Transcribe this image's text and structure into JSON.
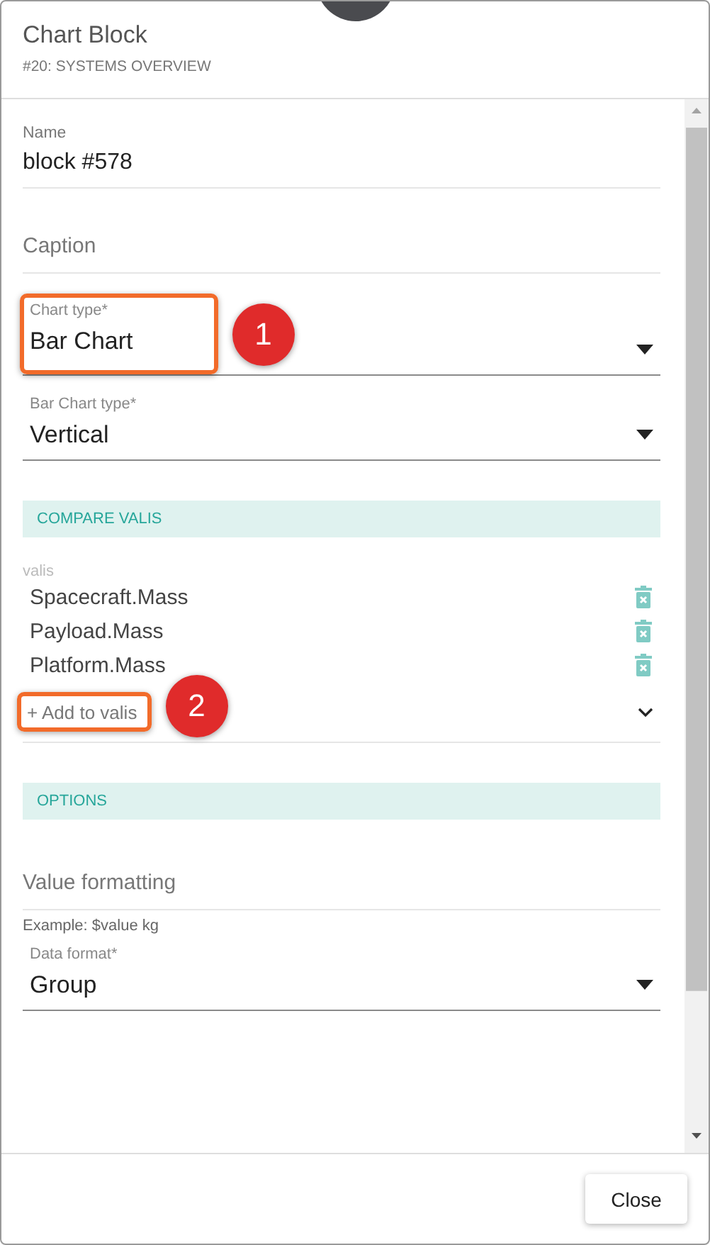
{
  "dialog": {
    "title": "Chart Block",
    "subtitle": "#20: SYSTEMS OVERVIEW"
  },
  "fields": [
    {
      "kind": "text",
      "label": "Name",
      "value": "block #578"
    },
    {
      "kind": "empty",
      "placeholder": "Caption"
    },
    {
      "kind": "select",
      "label": "Chart type*",
      "value": "Bar Chart",
      "annotation": "1"
    },
    {
      "kind": "select",
      "label": "Bar Chart type*",
      "value": "Vertical"
    },
    {
      "kind": "section",
      "label": "COMPARE VALIS"
    },
    {
      "kind": "list",
      "label": "valis",
      "items": [
        "Spacecraft.Mass",
        "Payload.Mass",
        "Platform.Mass"
      ],
      "add_placeholder": "+ Add to valis",
      "annotation": "2"
    },
    {
      "kind": "section",
      "label": "OPTIONS"
    },
    {
      "kind": "empty",
      "placeholder": "Value formatting",
      "hint": "Example: $value kg"
    },
    {
      "kind": "select",
      "label": "Data format*",
      "value": "Group"
    }
  ],
  "buttons": [
    "Close"
  ]
}
